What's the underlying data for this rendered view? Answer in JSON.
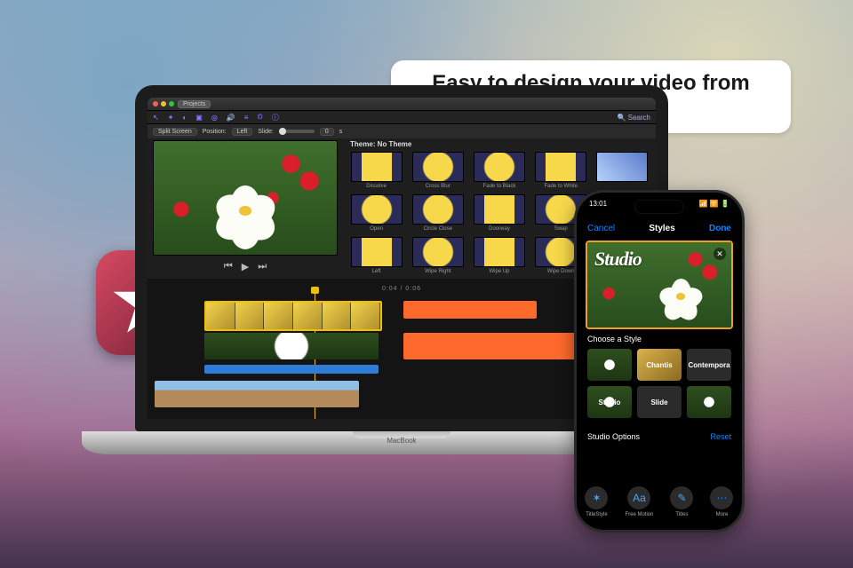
{
  "callout": {
    "text": "Easy to design your video from scratch"
  },
  "laptop": {
    "brand_label": "MacBook"
  },
  "app_icon": {
    "name": "imovie-star-icon"
  },
  "macos_app": {
    "titlebar": {
      "projects_btn": "Projects"
    },
    "search": {
      "placeholder": "Search"
    },
    "control_bar": {
      "clip_mode": "Split Screen",
      "position_label": "Position:",
      "position_value": "Left",
      "slide_label": "Slide:",
      "slide_value": "0",
      "slide_unit": "s"
    },
    "theme_header": "Theme: No Theme",
    "transitions": [
      {
        "label": "Dissolve",
        "style": "trans-yellow2"
      },
      {
        "label": "Cross Blur",
        "style": "trans-yellow"
      },
      {
        "label": "Fade to Black",
        "style": "trans-yellow"
      },
      {
        "label": "Fade to White",
        "style": "trans-yellow2"
      },
      {
        "label": "",
        "style": "trans-blue1"
      },
      {
        "label": "Open",
        "style": "trans-yellow"
      },
      {
        "label": "Circle Close",
        "style": "trans-yellow"
      },
      {
        "label": "Doorway",
        "style": "trans-yellow2"
      },
      {
        "label": "Swap",
        "style": "trans-yellow"
      },
      {
        "label": "",
        "style": "trans-blue2"
      },
      {
        "label": "Left",
        "style": "trans-yellow2"
      },
      {
        "label": "Wipe Right",
        "style": "trans-yellow"
      },
      {
        "label": "Wipe Up",
        "style": "trans-yellow2"
      },
      {
        "label": "Wipe Down",
        "style": "trans-yellow"
      },
      {
        "label": "",
        "style": "trans-blue1"
      }
    ],
    "playback_icons": {
      "prev": "⏮",
      "play": "▶",
      "next": "⏭"
    },
    "timecode": "0:04 / 0:06"
  },
  "phone": {
    "status": {
      "time": "13:01",
      "right": "📶 🛜 🔋"
    },
    "nav": {
      "cancel": "Cancel",
      "title": "Styles",
      "done": "Done"
    },
    "hero_title": "Studio",
    "section_styles": "Choose a Style",
    "styles": [
      {
        "label": "",
        "kind": "flowers"
      },
      {
        "label": "Chantis",
        "kind": "gold"
      },
      {
        "label": "Contempora",
        "kind": "dark"
      },
      {
        "label": "Studio",
        "kind": "flowers"
      },
      {
        "label": "Slide",
        "kind": "dark"
      },
      {
        "label": "",
        "kind": "flowers"
      }
    ],
    "section_options": "Studio Options",
    "reset_label": "Reset",
    "toolbar": [
      {
        "label": "TitleStyle",
        "glyph": "✶"
      },
      {
        "label": "Free Motion",
        "glyph": "Aa"
      },
      {
        "label": "Titles",
        "glyph": "✎"
      },
      {
        "label": "More",
        "glyph": "⋯"
      }
    ]
  }
}
